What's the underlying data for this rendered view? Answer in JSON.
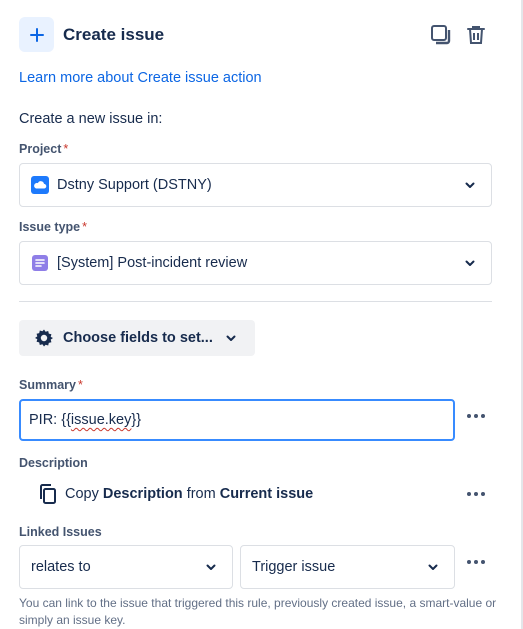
{
  "header": {
    "title": "Create issue",
    "icons": {
      "add": "plus-icon",
      "copy": "copy-icon",
      "delete": "trash-icon"
    }
  },
  "learn_more_link": "Learn more about Create issue action",
  "intro_text": "Create a new issue in:",
  "project": {
    "label": "Project",
    "required_mark": "*",
    "value": "Dstny Support (DSTNY)",
    "icon": "cloud-project-icon"
  },
  "issue_type": {
    "label": "Issue type",
    "required_mark": "*",
    "value": "[System] Post-incident review",
    "icon": "issue-type-icon"
  },
  "choose_fields": {
    "label": "Choose fields to set..."
  },
  "summary": {
    "label": "Summary",
    "required_mark": "*",
    "value_prefix": "PIR: {{",
    "value_key": "issue.key",
    "value_suffix": "}}"
  },
  "description": {
    "label": "Description",
    "copy_word": "Copy",
    "field": "Description",
    "from_word": "from",
    "source": "Current issue"
  },
  "linked_issues": {
    "label": "Linked Issues",
    "link_type": "relates to",
    "target": "Trigger issue",
    "helper_text": "You can link to the issue that triggered this rule, previously created issue, a smart-value or simply an issue key."
  },
  "colors": {
    "accent": "#0c66e4",
    "focus_border": "#388bff",
    "required": "#c9372c",
    "project_icon_bg": "#1d7afc",
    "issue_type_icon_bg": "#8f7ee7"
  }
}
